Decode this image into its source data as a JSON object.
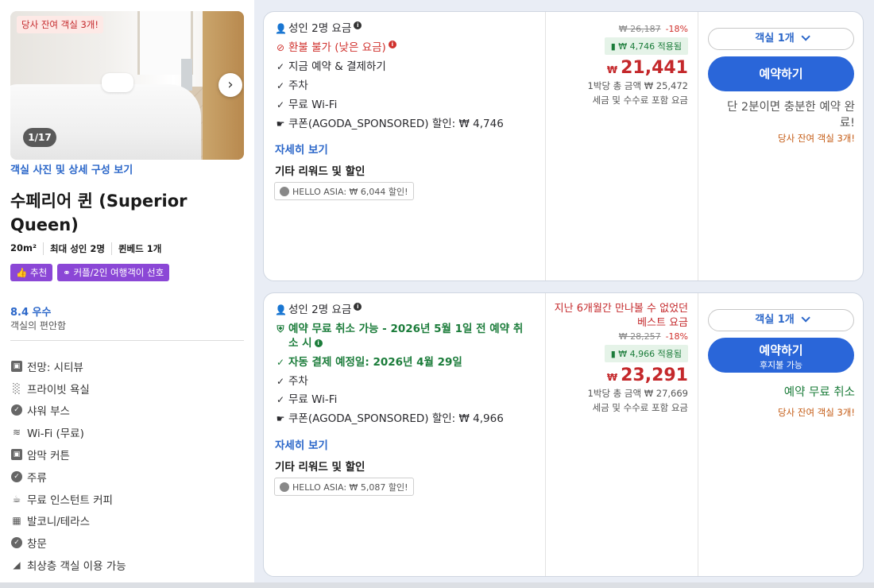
{
  "left": {
    "badge": "당사 잔여 객실 3개!",
    "photo_count": "1/17",
    "photo_next_icon": "chevron-right-icon",
    "photo_link": "객실 사진 및 상세 구성 보기",
    "room_title": "수페리어 퀸 (Superior Queen)",
    "specs": [
      "20m²",
      "최대 성인 2명",
      "퀸베드 1개"
    ],
    "tags": [
      {
        "icon": "thumbs-up-icon",
        "label": "추천"
      },
      {
        "icon": "couple-icon",
        "label": "커플/2인 여행객이 선호"
      }
    ],
    "rating": "8.4 우수",
    "rating_sub": "객실의 편안함",
    "amenities": [
      {
        "icon": "view-icon",
        "label": "전망: 시티뷰"
      },
      {
        "icon": "bath-icon",
        "label": "프라이빗 욕실"
      },
      {
        "icon": "check-circle-icon",
        "label": "샤워 부스"
      },
      {
        "icon": "wifi-icon",
        "label": "Wi-Fi (무료)"
      },
      {
        "icon": "curtain-icon",
        "label": "암막 커튼"
      },
      {
        "icon": "check-circle-icon",
        "label": "주류"
      },
      {
        "icon": "coffee-icon",
        "label": "무료 인스턴트 커피"
      },
      {
        "icon": "balcony-icon",
        "label": "발코니/테라스"
      },
      {
        "icon": "check-circle-icon",
        "label": "창문"
      },
      {
        "icon": "top-floor-icon",
        "label": "최상층 객실 이용 가능"
      }
    ]
  },
  "offers": [
    {
      "occupancy": "성인 2명 요금",
      "policy": "환불 불가 (낮은 요금)",
      "features": [
        "지금 예약 & 결제하기",
        "주차",
        "무료 Wi-Fi"
      ],
      "coupon": "쿠폰(AGODA_SPONSORED) 할인: ₩ 4,746",
      "more_link": "자세히 보기",
      "rewards_title": "기타 리워드 및 할인",
      "promo": "HELLO ASIA: ₩ 6,044 할인!",
      "original_price": "₩ 26,187",
      "discount_pct": "-18%",
      "applied": "₩ 4,746 적용됨",
      "currency": "₩",
      "price": "21,441",
      "total": "1박당 총 금액 ₩ 25,472",
      "tax_note": "세금 및 수수료 포함 요금",
      "room_select": "객실 1개",
      "book_label": "예약하기",
      "hint": "단 2분이면 충분한 예약 완료!",
      "rooms_left": "당사 잔여 객실 3개!"
    },
    {
      "occupancy": "성인 2명 요금",
      "policy": "예약 무료 취소 가능 - 2026년 5월 1일 전 예약 취소 시",
      "payment": "자동 결제 예정일: 2026년 4월 29일",
      "features": [
        "주차",
        "무료 Wi-Fi"
      ],
      "coupon": "쿠폰(AGODA_SPONSORED) 할인: ₩ 4,966",
      "more_link": "자세히 보기",
      "rewards_title": "기타 리워드 및 할인",
      "promo": "HELLO ASIA: ₩ 5,087 할인!",
      "best_price": "지난 6개월간 만나볼 수 없었던 베스트 요금",
      "original_price": "₩ 28,257",
      "discount_pct": "-18%",
      "applied": "₩ 4,966 적용됨",
      "currency": "₩",
      "price": "23,291",
      "total": "1박당 총 금액 ₩ 27,669",
      "tax_note": "세금 및 수수료 포함 요금",
      "room_select": "객실 1개",
      "book_label": "예약하기",
      "book_sub": "후지불 가능",
      "hint": "예약 무료 취소",
      "rooms_left": "당사 잔여 객실 3개!"
    }
  ],
  "colors": {
    "accent": "#2a66d9",
    "price": "#c4282b",
    "green": "#1b7c3a",
    "tag": "#8b47d6"
  }
}
